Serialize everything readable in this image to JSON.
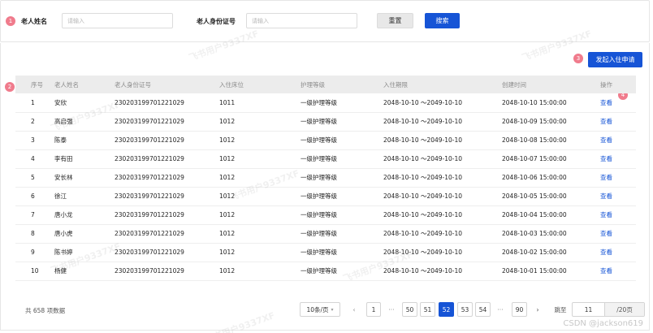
{
  "search": {
    "name_label": "老人姓名",
    "name_placeholder": "请输入",
    "id_label": "老人身份证号",
    "id_placeholder": "请输入",
    "reset_label": "重置",
    "search_label": "搜索"
  },
  "badges": [
    "1",
    "2",
    "3",
    "4"
  ],
  "apply_button": "发起入住申请",
  "table": {
    "headers": [
      "序号",
      "老人姓名",
      "老人身份证号",
      "入住床位",
      "护理等级",
      "入住期限",
      "创建时间",
      "操作"
    ],
    "rows": [
      [
        "1",
        "安欣",
        "230203199701221029",
        "1011",
        "一级护理等级",
        "2048-10-10 ～2049-10-10",
        "2048-10-10 15:00:00",
        "查看"
      ],
      [
        "2",
        "高启强",
        "230203199701221029",
        "1012",
        "一级护理等级",
        "2048-10-10 ～2049-10-10",
        "2048-10-09 15:00:00",
        "查看"
      ],
      [
        "3",
        "陈泰",
        "230203199701221029",
        "1012",
        "一级护理等级",
        "2048-10-10 ～2049-10-10",
        "2048-10-08 15:00:00",
        "查看"
      ],
      [
        "4",
        "李有田",
        "230203199701221029",
        "1012",
        "一级护理等级",
        "2048-10-10 ～2049-10-10",
        "2048-10-07 15:00:00",
        "查看"
      ],
      [
        "5",
        "安长林",
        "230203199701221029",
        "1012",
        "一级护理等级",
        "2048-10-10 ～2049-10-10",
        "2048-10-06 15:00:00",
        "查看"
      ],
      [
        "6",
        "徐江",
        "230203199701221029",
        "1012",
        "一级护理等级",
        "2048-10-10 ～2049-10-10",
        "2048-10-05 15:00:00",
        "查看"
      ],
      [
        "7",
        "唐小龙",
        "230203199701221029",
        "1012",
        "一级护理等级",
        "2048-10-10 ～2049-10-10",
        "2048-10-04 15:00:00",
        "查看"
      ],
      [
        "8",
        "唐小虎",
        "230203199701221029",
        "1012",
        "一级护理等级",
        "2048-10-10 ～2049-10-10",
        "2048-10-03 15:00:00",
        "查看"
      ],
      [
        "9",
        "陈书婷",
        "230203199701221029",
        "1012",
        "一级护理等级",
        "2048-10-10 ～2049-10-10",
        "2048-10-02 15:00:00",
        "查看"
      ],
      [
        "10",
        "杨健",
        "230203199701221029",
        "1012",
        "一级护理等级",
        "2048-10-10 ～2049-10-10",
        "2048-10-01 15:00:00",
        "查看"
      ]
    ]
  },
  "pagination": {
    "total": "共 658 项数据",
    "page_size": "10条/页",
    "pages": [
      "1",
      "50",
      "51",
      "52",
      "53",
      "54",
      "90"
    ],
    "current": "52",
    "ellipsis": "···",
    "prev": "‹",
    "next": "›",
    "goto_label": "跳至",
    "goto_value": "11",
    "goto_suffix": "/20页"
  },
  "watermark": "飞书用户9337XF",
  "csdn": "CSDN @jackson619",
  "colors": {
    "primary": "#1654d6",
    "badge": "#f07b8c"
  }
}
